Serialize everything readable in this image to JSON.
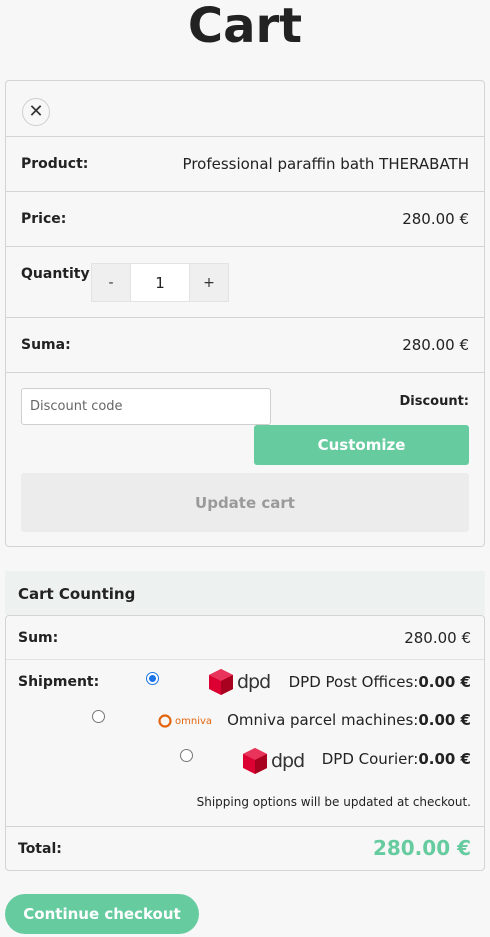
{
  "page": {
    "title": "Cart"
  },
  "cart": {
    "close_symbol": "✕",
    "product_label": "Product:",
    "product_value": "Professional paraffin bath THERABATH",
    "price_label": "Price:",
    "price_value": "280.00  €",
    "quantity_label": "Quantity:",
    "qty_minus": "-",
    "qty_value": "1",
    "qty_plus": "+",
    "sum_label": "Suma:",
    "sum_value": "280.00  €",
    "discount_placeholder": "Discount code",
    "discount_label": "Discount:",
    "customize_label": "Customize",
    "update_label": "Update cart"
  },
  "counting": {
    "title": "Cart Counting",
    "sum_label": "Sum:",
    "sum_value": "280.00  €",
    "shipment_label": "Shipment:",
    "options": [
      {
        "logo": "dpd-logo",
        "logo_text": "dpd",
        "name": "DPD Post Offices:",
        "price": "0.00  €",
        "selected": true
      },
      {
        "logo": "omniva-logo",
        "logo_text": "omniva",
        "name": "Omniva parcel machines:",
        "price": "0.00  €",
        "selected": false
      },
      {
        "logo": "dpd-logo",
        "logo_text": "dpd",
        "name": "DPD Courier:",
        "price": "0.00  €",
        "selected": false
      }
    ],
    "note": "Shipping options will be updated at checkout.",
    "total_label": "Total:",
    "total_value": "280.00  €"
  },
  "checkout_label": "Continue checkout",
  "colors": {
    "accent": "#67cba0",
    "dpd_red": "#dc0032",
    "omniva_orange": "#e3650d"
  }
}
